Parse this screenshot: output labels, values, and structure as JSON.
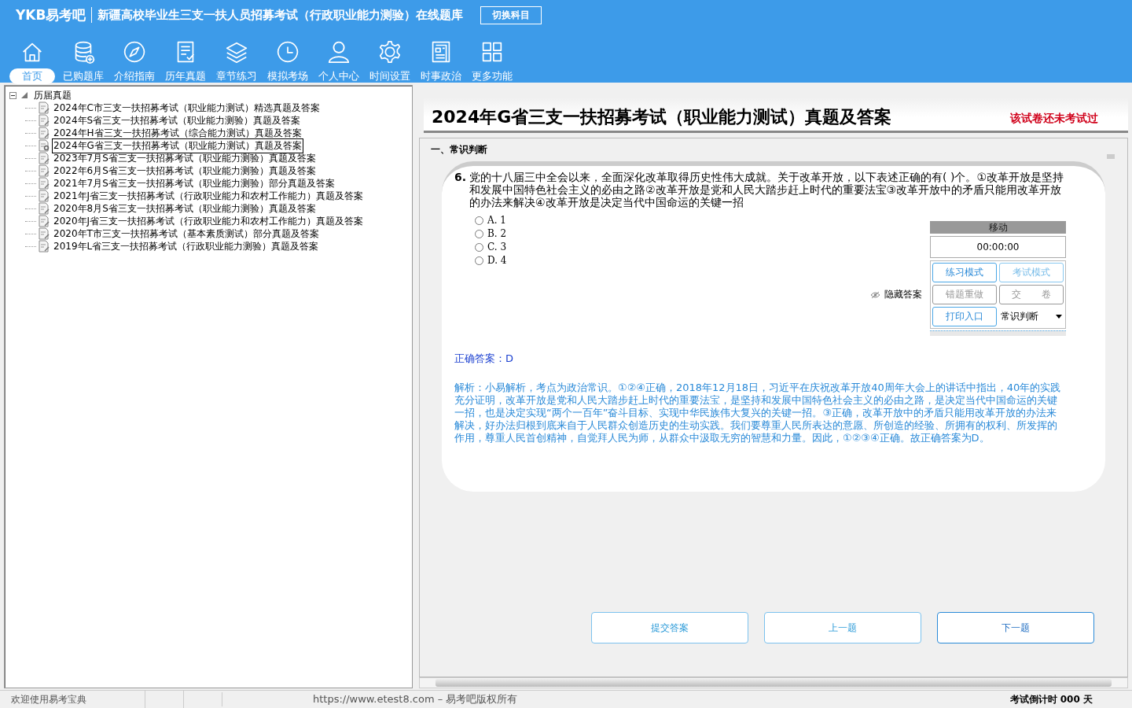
{
  "app": {
    "logo": "YKB易考吧",
    "title": "新疆高校毕业生三支一扶人员招募考试（行政职业能力测验）在线题库",
    "switch_button": "切换科目"
  },
  "toolbar": [
    {
      "label": "首页",
      "selected": true
    },
    {
      "label": "已购题库",
      "selected": false
    },
    {
      "label": "介绍指南",
      "selected": false
    },
    {
      "label": "历年真题",
      "selected": false
    },
    {
      "label": "章节练习",
      "selected": false
    },
    {
      "label": "模拟考场",
      "selected": false
    },
    {
      "label": "个人中心",
      "selected": false
    },
    {
      "label": "时间设置",
      "selected": false
    },
    {
      "label": "时事政治",
      "selected": false
    },
    {
      "label": "更多功能",
      "selected": false
    }
  ],
  "tree": {
    "label": "历届真题",
    "expanded": true,
    "children": [
      {
        "label": "2024年C市三支一扶招募考试（职业能力测试）精选真题及答案",
        "selected": false
      },
      {
        "label": "2024年S省三支一扶招募考试（职业能力测验）真题及答案",
        "selected": false
      },
      {
        "label": "2024年H省三支一扶招募考试（综合能力测试）真题及答案",
        "selected": false
      },
      {
        "label": "2024年G省三支一扶招募考试（职业能力测试）真题及答案",
        "selected": true
      },
      {
        "label": "2023年7月S省三支一扶招募考试（职业能力测验）真题及答案",
        "selected": false
      },
      {
        "label": "2022年6月S省三支一扶招募考试（职业能力测验）真题及答案",
        "selected": false
      },
      {
        "label": "2021年7月S省三支一扶招募考试（职业能力测验）部分真题及答案",
        "selected": false
      },
      {
        "label": "2021年J省三支一扶招募考试（行政职业能力和农村工作能力）真题及答案",
        "selected": false
      },
      {
        "label": "2020年8月S省三支一扶招募考试（职业能力测验）真题及答案",
        "selected": false
      },
      {
        "label": "2020年J省三支一扶招募考试（行政职业能力和农村工作能力）真题及答案",
        "selected": false
      },
      {
        "label": "2020年T市三支一扶招募考试（基本素质测试）部分真题及答案",
        "selected": false
      },
      {
        "label": "2019年L省三支一扶招募考试（行政职业能力测验）真题及答案",
        "selected": false
      }
    ]
  },
  "paper": {
    "title": "2024年G省三支一扶招募考试（职业能力测试）真题及答案",
    "status": "该试卷还未考试过",
    "section": "一、常识判断",
    "question": {
      "number": "6.",
      "text": "党的十八届三中全会以来，全面深化改革取得历史性伟大成就。关于改革开放，以下表述正确的有( )个。①改革开放是坚持和发展中国特色社会主义的必由之路②改革开放是党和人民大踏步赶上时代的重要法宝③改革开放中的矛盾只能用改革开放的办法来解决④改革开放是决定当代中国命运的关键一招",
      "options": [
        {
          "label": "A. 1",
          "selected": false
        },
        {
          "label": "B. 2",
          "selected": false
        },
        {
          "label": "C. 3",
          "selected": false
        },
        {
          "label": "D. 4",
          "selected": false
        }
      ],
      "answer": "正确答案：D",
      "analysis": "解析：小易解析，考点为政治常识。①②④正确，2018年12月18日，习近平在庆祝改革开放40周年大会上的讲话中指出，40年的实践充分证明，改革开放是党和人民大踏步赶上时代的重要法宝，是坚持和发展中国特色社会主义的必由之路，是决定当代中国命运的关键一招，也是决定实现“两个一百年”奋斗目标、实现中华民族伟大复兴的关键一招。③正确，改革开放中的矛盾只能用改革开放的办法来解决，好办法归根到底来自于人民群众创造历史的生动实践。我们要尊重人民所表达的意愿、所创造的经验、所拥有的权利、所发挥的作用，尊重人民首创精神，自觉拜人民为师，从群众中汲取无穷的智慧和力量。因此，①②③④正确。故正确答案为D。"
    },
    "hide_answer": "隐藏答案",
    "panel": {
      "header": "移动",
      "timer": "00:00:00",
      "buttons": [
        {
          "label": "练习模式",
          "disabled": false
        },
        {
          "label": "考试模式",
          "disabled": false
        },
        {
          "label": "错题重做",
          "disabled": true
        },
        {
          "label": "交 卷",
          "disabled": true
        },
        {
          "label": "打印入口",
          "disabled": false
        }
      ],
      "category": "常识判断"
    },
    "nav_buttons": [
      "提交答案",
      "上一题",
      "下一题"
    ]
  },
  "status_bar": {
    "welcome": "欢迎使用易考宝典",
    "copyright": "https://www.etest8.com – 易考吧版权所有",
    "countdown": "考试倒计时 000 天"
  }
}
